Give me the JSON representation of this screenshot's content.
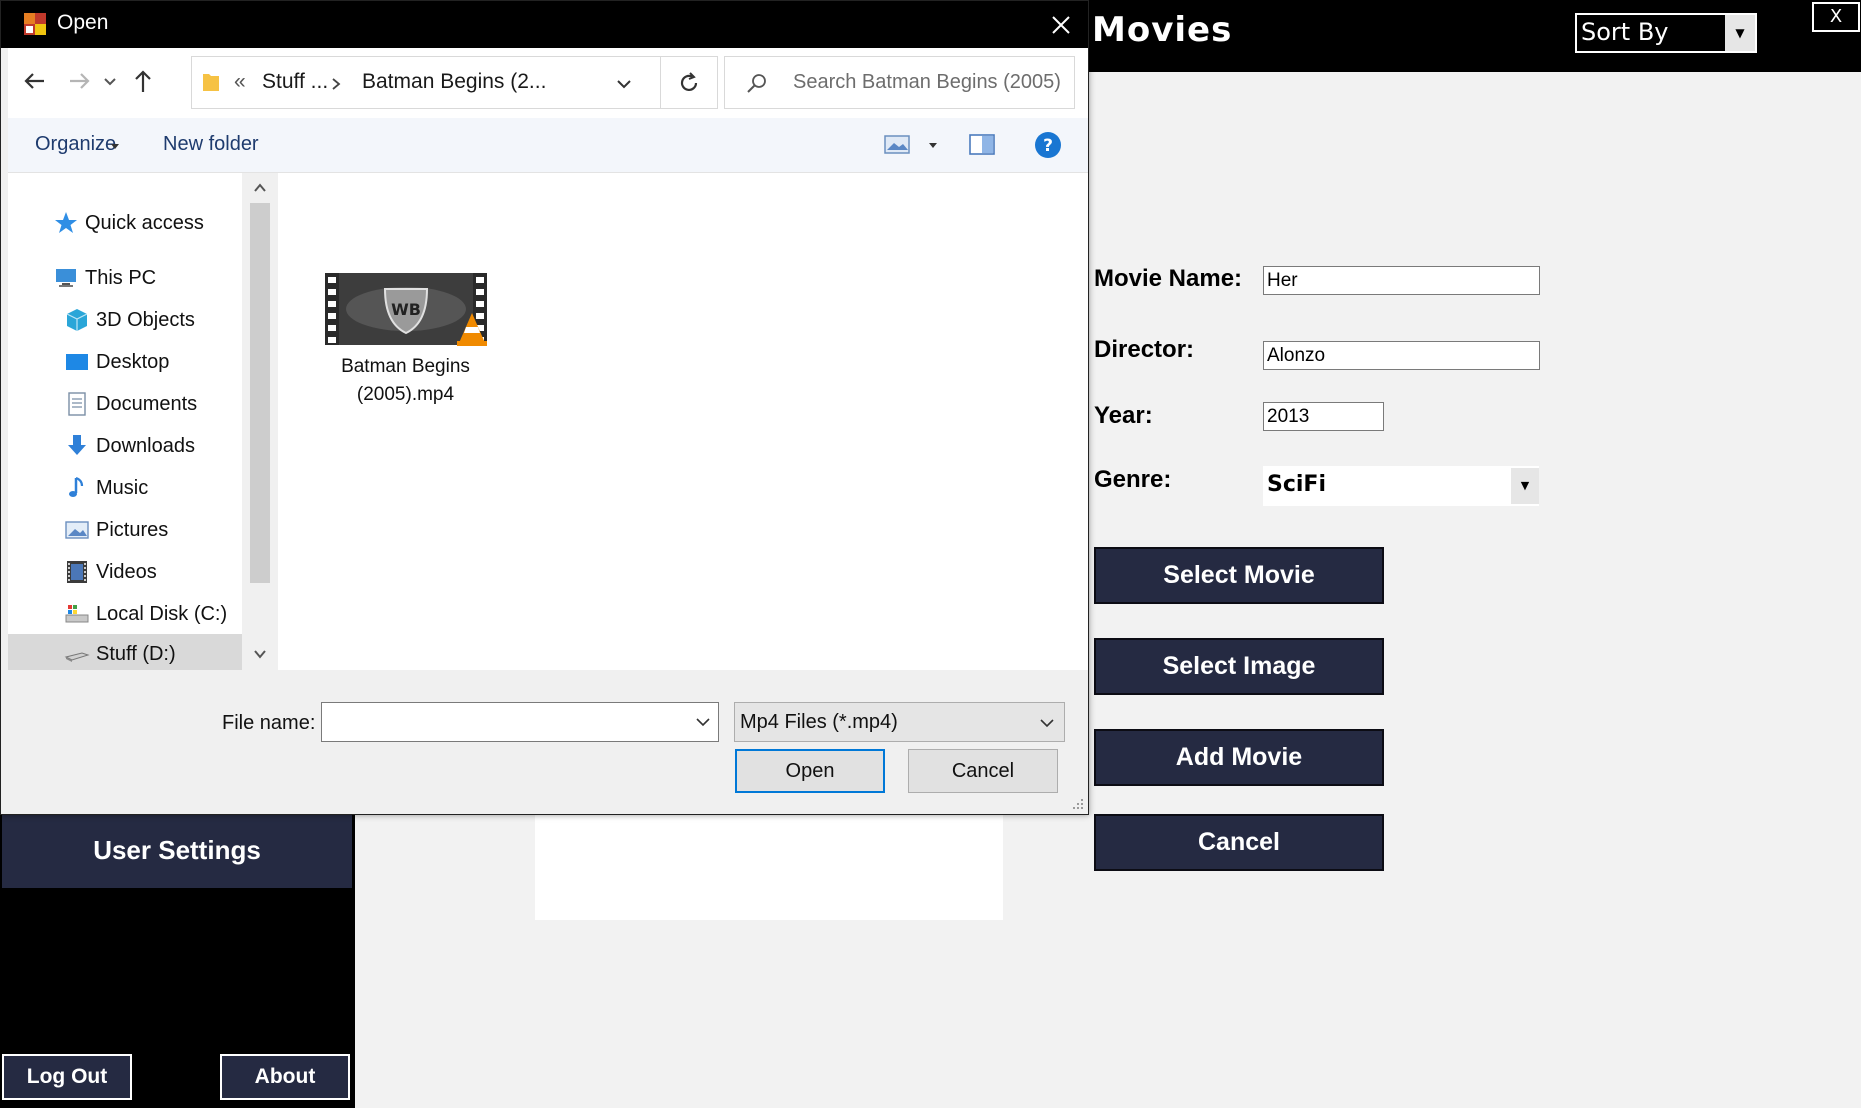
{
  "app": {
    "title": "Movies",
    "sort_by_label": "Sort By",
    "close_label": "X",
    "sidebar": {
      "user_settings_label": "User Settings",
      "logout_label": "Log Out",
      "about_label": "About"
    },
    "form": {
      "movie_name_label": "Movie Name:",
      "movie_name_value": "Her",
      "director_label": "Director:",
      "director_value": "Alonzo",
      "year_label": "Year:",
      "year_value": "2013",
      "genre_label": "Genre:",
      "genre_value": "SciFi"
    },
    "buttons": {
      "select_movie": "Select Movie",
      "select_image": "Select Image",
      "add_movie": "Add Movie",
      "cancel": "Cancel"
    },
    "colors": {
      "header_bg": "#000000",
      "button_bg": "#252a42",
      "content_bg": "#f2f2f2"
    }
  },
  "dialog": {
    "title": "Open",
    "breadcrumb": {
      "overflow": "«",
      "parent": "Stuff ...",
      "current": "Batman Begins (2..."
    },
    "search_placeholder": "Search Batman Begins (2005)",
    "commands": {
      "organize": "Organize",
      "new_folder": "New folder"
    },
    "nav": [
      {
        "label": "Quick access",
        "icon": "star-icon"
      },
      {
        "label": "This PC",
        "icon": "computer-icon"
      },
      {
        "label": "3D Objects",
        "icon": "cube-icon"
      },
      {
        "label": "Desktop",
        "icon": "desktop-icon"
      },
      {
        "label": "Documents",
        "icon": "document-icon"
      },
      {
        "label": "Downloads",
        "icon": "download-arrow-icon"
      },
      {
        "label": "Music",
        "icon": "music-note-icon"
      },
      {
        "label": "Pictures",
        "icon": "picture-icon"
      },
      {
        "label": "Videos",
        "icon": "film-icon"
      },
      {
        "label": "Local Disk (C:)",
        "icon": "drive-icon"
      },
      {
        "label": "Stuff (D:)",
        "icon": "drive-icon",
        "selected": true
      }
    ],
    "files": [
      {
        "name_line1": "Batman Begins",
        "name_line2": "(2005).mp4",
        "icon": "video-thumbnail-icon"
      }
    ],
    "file_name_label": "File name:",
    "file_name_value": "",
    "file_type_filter": "Mp4 Files (*.mp4)",
    "open_label": "Open",
    "cancel_label": "Cancel",
    "colors": {
      "titlebar_bg": "#000000",
      "accent": "#0078d7",
      "help_icon": "#1976d2"
    }
  }
}
